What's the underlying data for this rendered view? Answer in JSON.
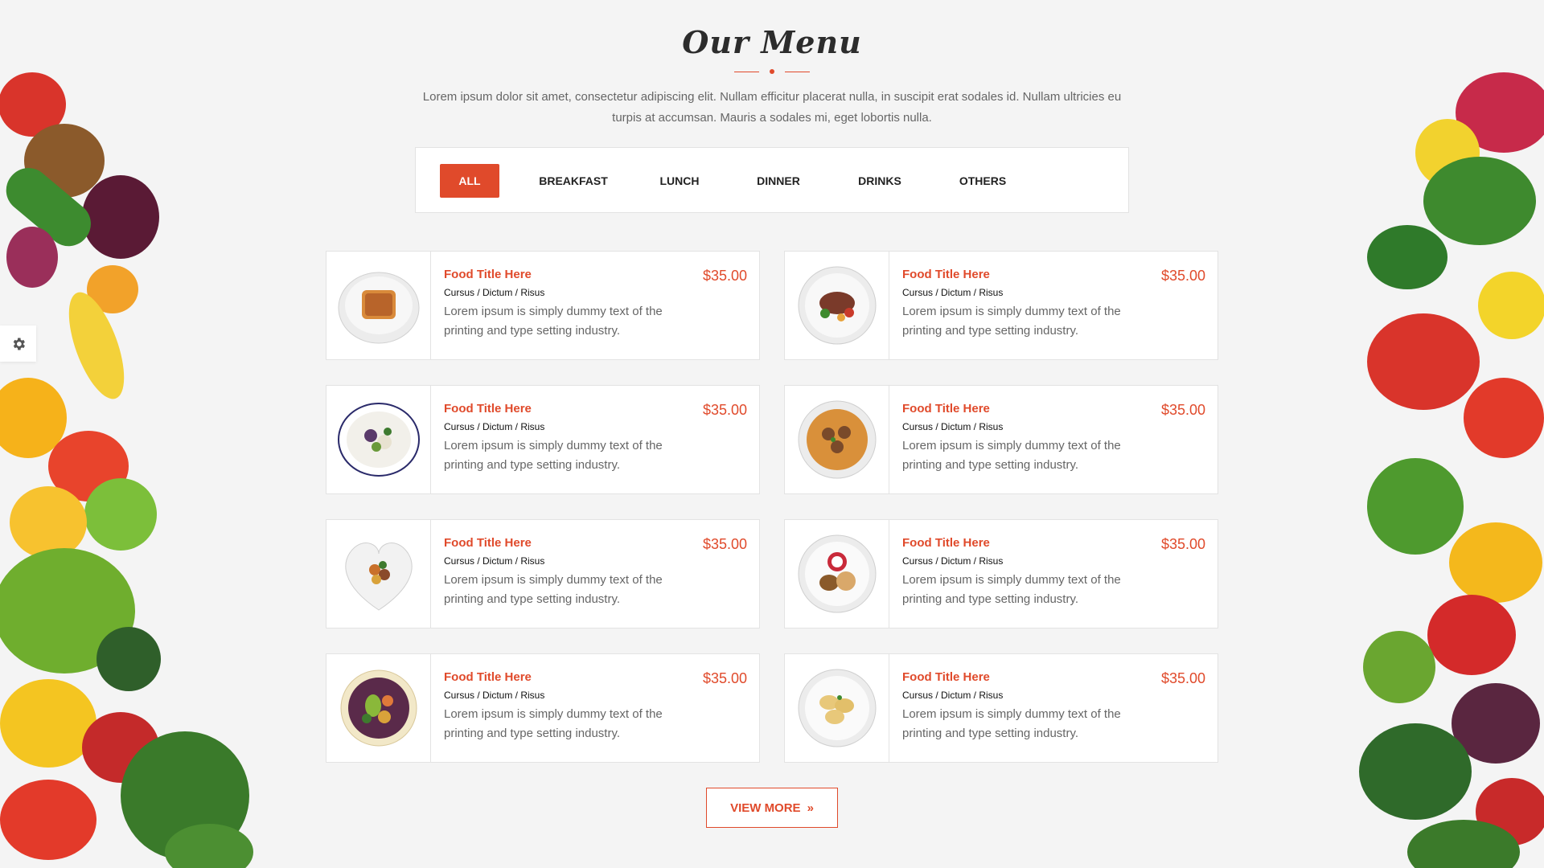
{
  "section": {
    "title": "Our Menu",
    "intro": "Lorem ipsum dolor sit amet, consectetur adipiscing elit. Nullam efficitur placerat nulla, in suscipit erat sodales id. Nullam ultricies eu turpis at accumsan. Mauris a sodales mi, eget lobortis nulla."
  },
  "filters": [
    "ALL",
    "BREAKFAST",
    "LUNCH",
    "DINNER",
    "DRINKS",
    "OTHERS"
  ],
  "active_filter": "ALL",
  "items": [
    {
      "title": "Food Title Here",
      "categories": "Cursus / Dictum / Risus",
      "description": "Lorem ipsum is simply dummy text of the printing and type setting industry.",
      "price": "$35.00",
      "dish": "lasagna-plate"
    },
    {
      "title": "Food Title Here",
      "categories": "Cursus / Dictum / Risus",
      "description": "Lorem ipsum is simply dummy text of the printing and type setting industry.",
      "price": "$35.00",
      "dish": "steak-plate"
    },
    {
      "title": "Food Title Here",
      "categories": "Cursus / Dictum / Risus",
      "description": "Lorem ipsum is simply dummy text of the printing and type setting industry.",
      "price": "$35.00",
      "dish": "salad-bowl"
    },
    {
      "title": "Food Title Here",
      "categories": "Cursus / Dictum / Risus",
      "description": "Lorem ipsum is simply dummy text of the printing and type setting industry.",
      "price": "$35.00",
      "dish": "pasta-meatballs-plate"
    },
    {
      "title": "Food Title Here",
      "categories": "Cursus / Dictum / Risus",
      "description": "Lorem ipsum is simply dummy text of the printing and type setting industry.",
      "price": "$35.00",
      "dish": "heart-dish"
    },
    {
      "title": "Food Title Here",
      "categories": "Cursus / Dictum / Risus",
      "description": "Lorem ipsum is simply dummy text of the printing and type setting industry.",
      "price": "$35.00",
      "dish": "bread-salad-plate"
    },
    {
      "title": "Food Title Here",
      "categories": "Cursus / Dictum / Risus",
      "description": "Lorem ipsum is simply dummy text of the printing and type setting industry.",
      "price": "$35.00",
      "dish": "avocado-bowl"
    },
    {
      "title": "Food Title Here",
      "categories": "Cursus / Dictum / Risus",
      "description": "Lorem ipsum is simply dummy text of the printing and type setting industry.",
      "price": "$35.00",
      "dish": "ravioli-plate"
    }
  ],
  "view_more": {
    "label": "VIEW MORE",
    "icon": "double-chevron-right-icon",
    "glyph": "»"
  },
  "colors": {
    "accent": "#e04a2b",
    "background": "#f4f4f4",
    "card": "#ffffff",
    "border": "#e3e3e3"
  },
  "icons": {
    "settings": "gear-icon"
  }
}
